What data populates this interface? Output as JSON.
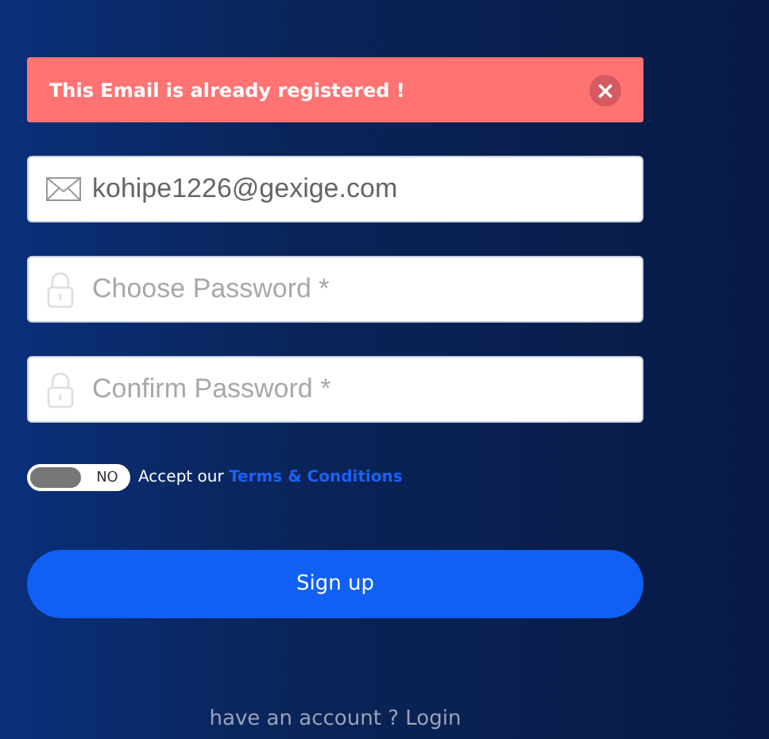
{
  "alert": {
    "message": "This Email is already registered !",
    "close": "×"
  },
  "fields": [
    {
      "kind": "email",
      "value": "kohipe1226@gexige.com"
    },
    {
      "kind": "password",
      "placeholder": "Choose Password *"
    },
    {
      "kind": "password",
      "placeholder": "Confirm Password *"
    }
  ],
  "terms": {
    "on": false,
    "toggle_label": "NO",
    "text": "Accept our",
    "link": "Terms & Conditions"
  },
  "submit": "Sign up",
  "footer": {
    "text": "have an account ?",
    "link": "Login"
  }
}
